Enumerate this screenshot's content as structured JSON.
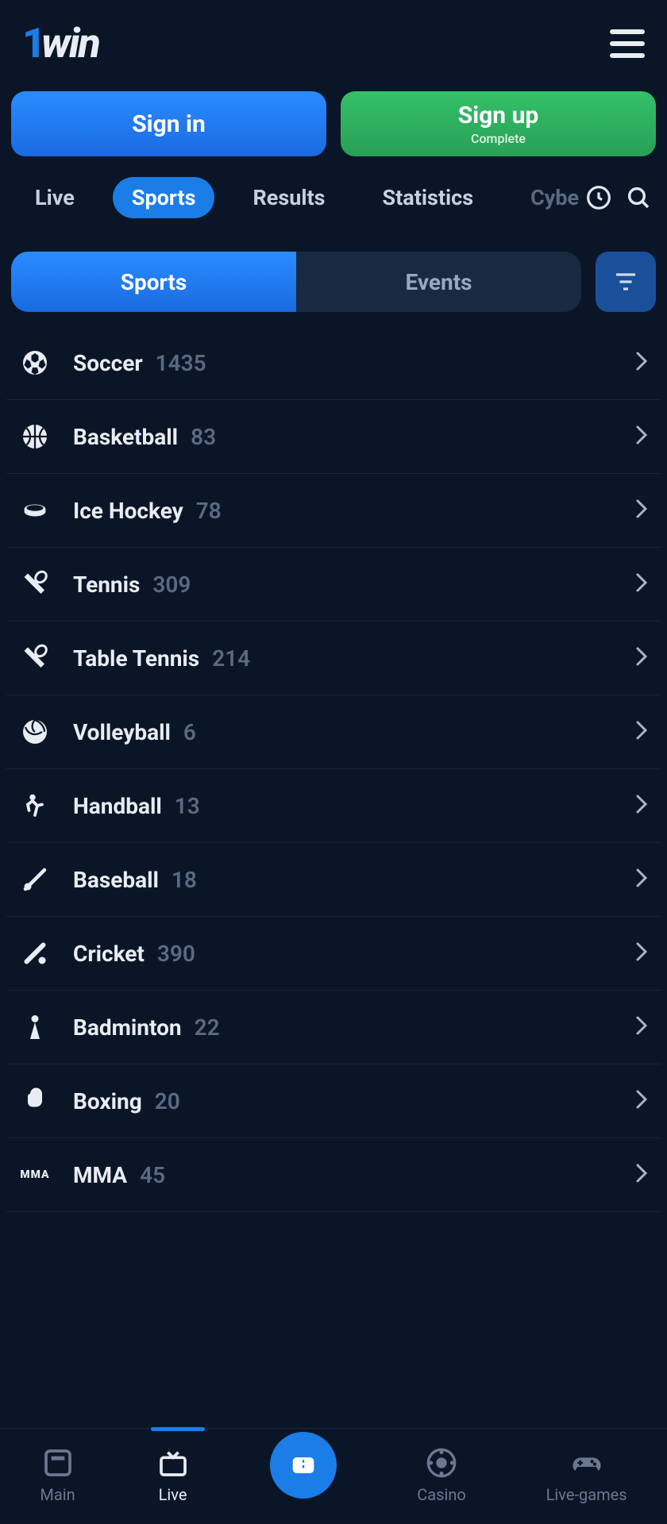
{
  "logo": {
    "prefix": "1",
    "suffix": "win"
  },
  "auth": {
    "signin": "Sign in",
    "signup": "Sign up",
    "signup_sub": "Complete"
  },
  "nav": {
    "items": [
      {
        "label": "Live",
        "active": false,
        "faded": false
      },
      {
        "label": "Sports",
        "active": true,
        "faded": false
      },
      {
        "label": "Results",
        "active": false,
        "faded": false
      },
      {
        "label": "Statistics",
        "active": false,
        "faded": false
      },
      {
        "label": "Cyber",
        "active": false,
        "faded": true
      }
    ]
  },
  "toggle": {
    "sports": "Sports",
    "events": "Events",
    "active": "sports"
  },
  "sports_list": [
    {
      "icon": "soccer",
      "name": "Soccer",
      "count": 1435
    },
    {
      "icon": "basketball",
      "name": "Basketball",
      "count": 83
    },
    {
      "icon": "hockey",
      "name": "Ice Hockey",
      "count": 78
    },
    {
      "icon": "tennis",
      "name": "Tennis",
      "count": 309
    },
    {
      "icon": "tennis",
      "name": "Table Tennis",
      "count": 214
    },
    {
      "icon": "volleyball",
      "name": "Volleyball",
      "count": 6
    },
    {
      "icon": "handball",
      "name": "Handball",
      "count": 13
    },
    {
      "icon": "baseball",
      "name": "Baseball",
      "count": 18
    },
    {
      "icon": "cricket",
      "name": "Cricket",
      "count": 390
    },
    {
      "icon": "badminton",
      "name": "Badminton",
      "count": 22
    },
    {
      "icon": "boxing",
      "name": "Boxing",
      "count": 20
    },
    {
      "icon": "mma",
      "name": "MMA",
      "count": 45
    }
  ],
  "bottom_nav": [
    {
      "icon": "main",
      "label": "Main",
      "active": false
    },
    {
      "icon": "live",
      "label": "Live",
      "active": true
    },
    {
      "icon": "ticket",
      "label": "",
      "active": false,
      "center": true
    },
    {
      "icon": "casino",
      "label": "Casino",
      "active": false
    },
    {
      "icon": "games",
      "label": "Live-games",
      "active": false
    }
  ]
}
